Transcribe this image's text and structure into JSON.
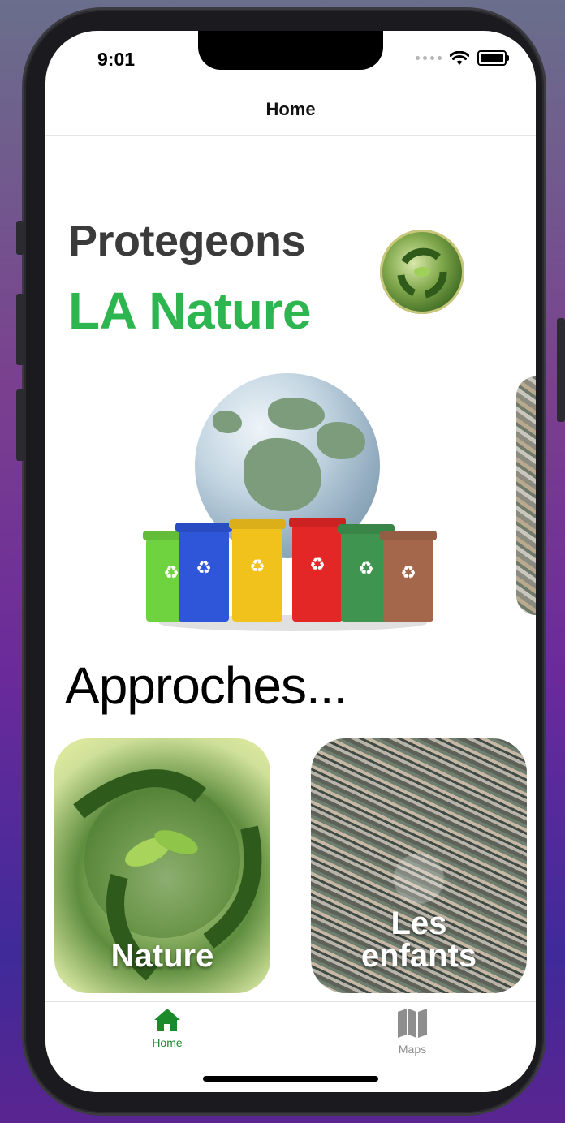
{
  "status_bar": {
    "time": "9:01"
  },
  "nav": {
    "title": "Home"
  },
  "hero": {
    "line1": "Protegeons",
    "line2": "LA Nature"
  },
  "section": {
    "title": "Approches..."
  },
  "cards": [
    {
      "label": "Nature"
    },
    {
      "label": "Les enfants"
    }
  ],
  "tabbar": {
    "items": [
      {
        "label": "Home",
        "icon": "house-icon",
        "active": true
      },
      {
        "label": "Maps",
        "icon": "map-icon",
        "active": false
      }
    ]
  },
  "colors": {
    "accent_green": "#2db54f",
    "title_gray": "#3b3b3b",
    "tab_active": "#1a8a2a",
    "tab_inactive": "#8e8e8e"
  }
}
